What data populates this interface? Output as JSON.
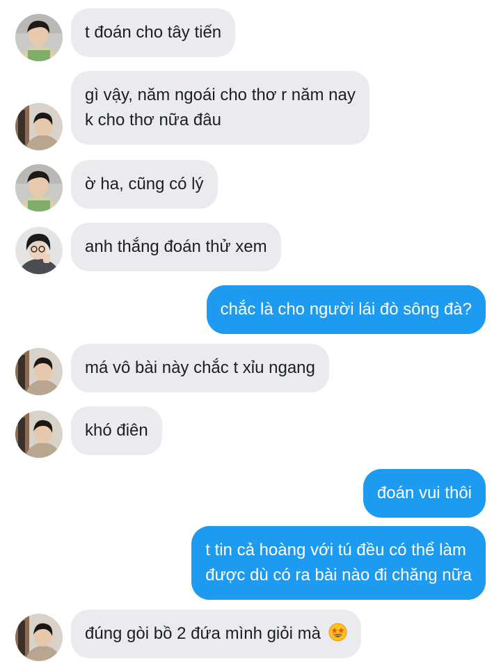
{
  "messages": [
    {
      "dir": "in",
      "avatar": "avatar-1",
      "lines": [
        "t đoán cho tây tiến"
      ]
    },
    {
      "dir": "in",
      "avatar": "avatar-2",
      "lines": [
        "gì vậy, năm ngoái cho thơ r năm nay",
        "k cho thơ nữa đâu"
      ]
    },
    {
      "dir": "in",
      "avatar": "avatar-1",
      "lines": [
        "ờ ha, cũng có lý"
      ]
    },
    {
      "dir": "in",
      "avatar": "avatar-3",
      "lines": [
        "anh thắng đoán thử xem"
      ]
    },
    {
      "dir": "out",
      "lines": [
        "chắc là cho người lái đò sông đà?"
      ]
    },
    {
      "dir": "in",
      "avatar": "avatar-2",
      "lines": [
        "má vô bài này chắc t xỉu ngang"
      ]
    },
    {
      "dir": "in",
      "avatar": "avatar-2",
      "lines": [
        "khó điên"
      ]
    },
    {
      "dir": "out",
      "lines": [
        "đoán vui thôi"
      ]
    },
    {
      "dir": "out",
      "lines": [
        "t tin cả hoàng với tú đều có thể làm",
        "được dù có ra bài nào đi chăng nữa"
      ]
    },
    {
      "dir": "in",
      "avatar": "avatar-2",
      "lines": [
        "đúng gòi bồ 2 đứa mình giỏi mà"
      ],
      "emoji": "star-struck-emoji"
    }
  ],
  "colors": {
    "incoming_bubble": "#e9ebef",
    "outgoing_bubble": "#1d9bf0",
    "incoming_text": "#1c1e21",
    "outgoing_text": "#ffffff"
  }
}
